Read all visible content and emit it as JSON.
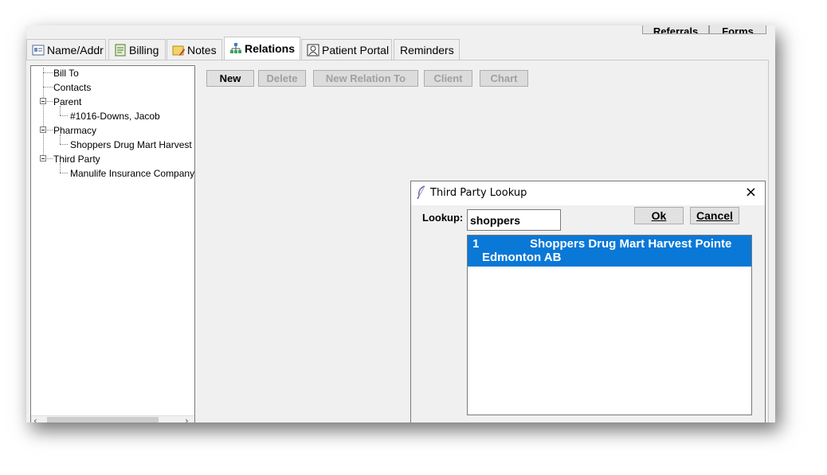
{
  "top_buttons": {
    "referrals": "Referrals",
    "forms": "Forms"
  },
  "tabs": [
    {
      "label": "Name/Addr",
      "icon": "address-card-icon"
    },
    {
      "label": "Billing",
      "icon": "billing-icon"
    },
    {
      "label": "Notes",
      "icon": "notes-icon"
    },
    {
      "label": "Relations",
      "icon": "relations-icon",
      "active": true
    },
    {
      "label": "Patient Portal",
      "icon": "portal-icon"
    },
    {
      "label": "Reminders",
      "icon": ""
    }
  ],
  "tree": {
    "bill_to": "Bill To",
    "contacts": "Contacts",
    "parent": "Parent",
    "parent_child": "#1016-Downs, Jacob",
    "pharmacy": "Pharmacy",
    "pharmacy_child": "Shoppers Drug Mart Harvest",
    "third_party": "Third Party",
    "third_party_child": "Manulife Insurance Company"
  },
  "actions": {
    "new": "New",
    "delete": "Delete",
    "new_relation_to": "New Relation To",
    "client": "Client",
    "chart": "Chart"
  },
  "dialog": {
    "title": "Third Party Lookup",
    "close": "×",
    "lookup_label": "Lookup:",
    "lookup_value": "shoppers",
    "ok_label": "Ok",
    "cancel_label": "Cancel",
    "results": [
      {
        "number": "1",
        "name": "Shoppers Drug Mart Harvest Pointe",
        "location": "Edmonton  AB",
        "selected": true
      }
    ]
  },
  "colors": {
    "selection": "#0a78d7",
    "window_bg": "#f0f0f0"
  }
}
